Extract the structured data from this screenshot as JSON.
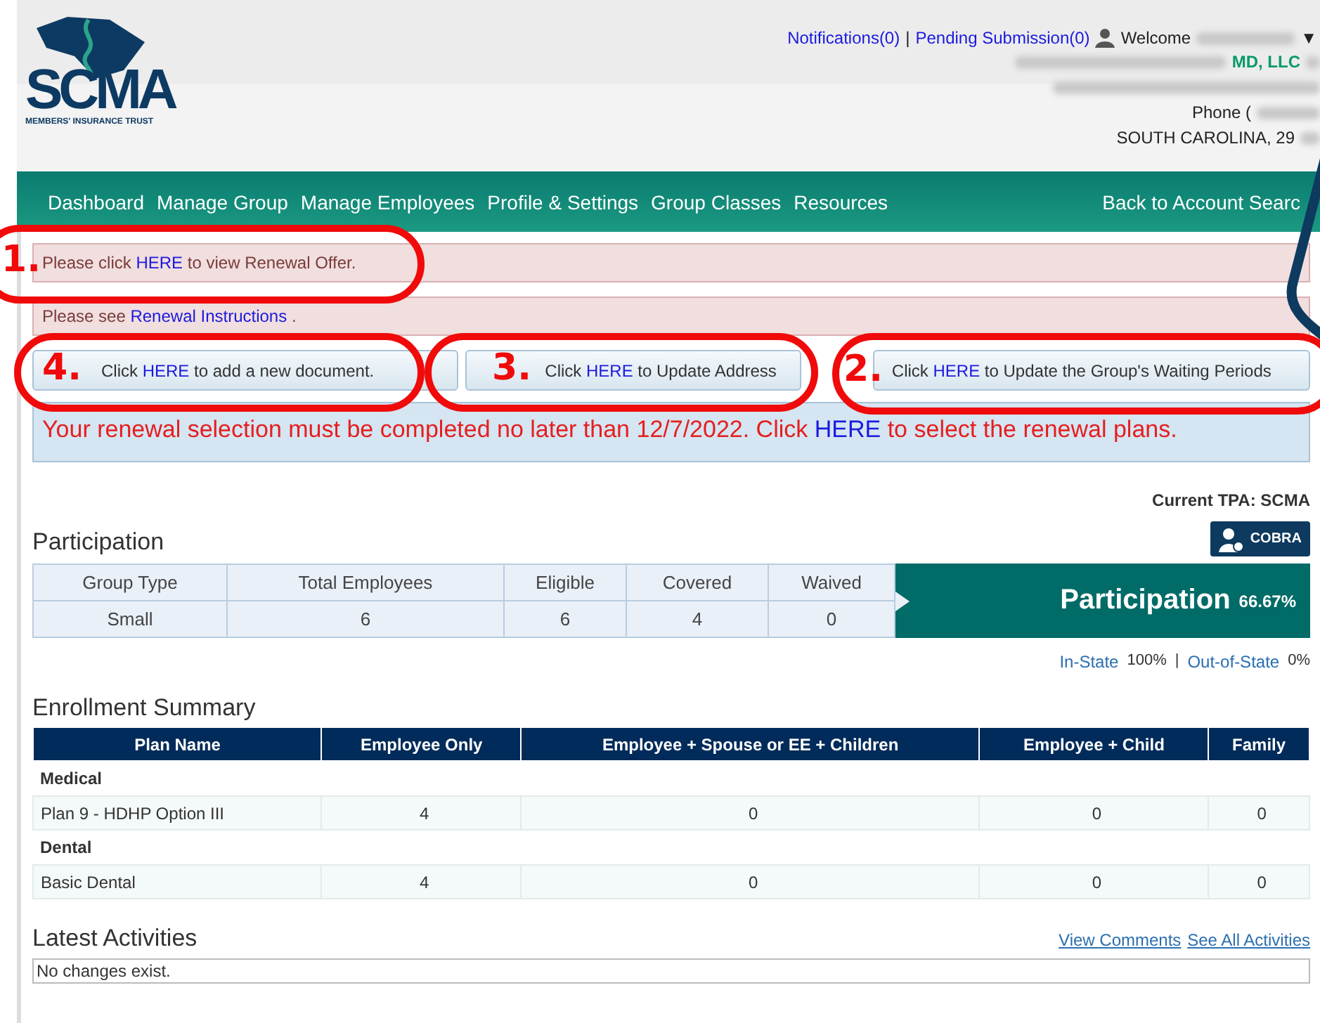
{
  "header": {
    "logo": {
      "name": "SCMA",
      "tagline": "MEMBERS' INSURANCE TRUST"
    },
    "top_links": [
      {
        "text": "Notifications(0)"
      },
      {
        "text": "Pending Submission(0)"
      }
    ],
    "separator": "|",
    "welcome": "Welcome",
    "menu_caret": "▼",
    "company": "MD, LLC",
    "phone": "Phone (",
    "address": "SOUTH CAROLINA, 29"
  },
  "nav": {
    "items": [
      "Dashboard",
      "Manage Group",
      "Manage Employees",
      "Profile & Settings",
      "Group Classes",
      "Resources"
    ],
    "right_link": "Back to Account Searc"
  },
  "alerts": [
    {
      "before": "Please click ",
      "link": "HERE",
      "after": " to view Renewal Offer."
    },
    {
      "before": "Please see ",
      "link": "Renewal Instructions",
      "after": " ."
    }
  ],
  "action_buttons": [
    {
      "before": "Click ",
      "link": "HERE",
      "after": " to add a new document."
    },
    {
      "before": "Click ",
      "link": "HERE",
      "after": " to Update Address"
    },
    {
      "before": "Click ",
      "link": "HERE",
      "after": " to Update the Group's Waiting Periods"
    }
  ],
  "deadline": {
    "before": "Your renewal selection must be completed no later than 12/7/2022. Click ",
    "link": "HERE",
    "after": " to select the renewal plans."
  },
  "tpa": "Current TPA: SCMA",
  "participation": {
    "title": "Participation",
    "cobra": "COBRA",
    "columns": [
      "Group Type",
      "Total Employees",
      "Eligible",
      "Covered",
      "Waived"
    ],
    "row": [
      "Small",
      "6",
      "6",
      "4",
      "0"
    ],
    "summary_label": "Participation",
    "summary_value": "66.67%",
    "in_state": {
      "label": "In-State",
      "value": "100%"
    },
    "divider": "|",
    "out_state": {
      "label": "Out-of-State",
      "value": "0%"
    }
  },
  "enrollment": {
    "title": "Enrollment Summary",
    "columns": [
      "Plan Name",
      "Employee Only",
      "Employee + Spouse or EE + Children",
      "Employee + Child",
      "Family"
    ],
    "groups": [
      {
        "name": "Medical",
        "rows": [
          [
            "Plan 9 - HDHP Option III",
            "4",
            "0",
            "0",
            "0"
          ]
        ]
      },
      {
        "name": "Dental",
        "rows": [
          [
            "Basic Dental",
            "4",
            "0",
            "0",
            "0"
          ]
        ]
      }
    ]
  },
  "activities": {
    "title": "Latest Activities",
    "links": [
      "View Comments",
      "See All Activities"
    ],
    "empty": "No changes exist."
  },
  "annotations": [
    {
      "label": "1."
    },
    {
      "label": "4."
    },
    {
      "label": "3."
    },
    {
      "label": "2."
    }
  ]
}
